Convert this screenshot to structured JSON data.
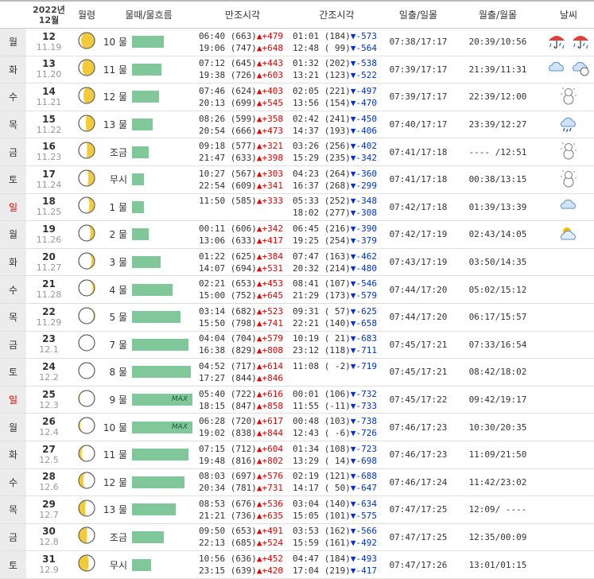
{
  "header": {
    "year": "2022년",
    "month": "12월",
    "moon_phase": "월령",
    "tide_flow": "물때/물흐름",
    "high_tide": "만조시각",
    "low_tide": "간조시각",
    "sunrise_sunset": "일출/일몰",
    "moonrise_moonset": "월출/월몰",
    "weather": "날씨"
  },
  "colors": {
    "bar": "#80c89a",
    "rise": "#e60000",
    "fall": "#0033cc",
    "sunday": "#e00000",
    "weekday_bg": "#ececec"
  },
  "rows": [
    {
      "weekday": "월",
      "sunday": false,
      "day": "12",
      "lunar": "11.19",
      "moon_icon": "waning-gibbous-icon",
      "moon_lit": 0.85,
      "moon_side": "right",
      "mulddae": "10 물",
      "bar": 0.52,
      "max": "",
      "high": [
        {
          "t": "06:40",
          "v": "(663)",
          "arrow": "▲",
          "d": "+479"
        },
        {
          "t": "19:06",
          "v": "(747)",
          "arrow": "▲",
          "d": "+648"
        }
      ],
      "low": [
        {
          "t": "01:01",
          "v": "(184)",
          "arrow": "▼",
          "d": "-573"
        },
        {
          "t": "12:48",
          "v": "( 99)",
          "arrow": "▼",
          "d": "-564"
        }
      ],
      "sun": "07:38/17:17",
      "moon": "20:39/10:56",
      "weather": [
        "rain-umbrella-icon",
        "rain-umbrella-icon"
      ]
    },
    {
      "weekday": "화",
      "sunday": false,
      "day": "13",
      "lunar": "11.20",
      "moon_icon": "waning-gibbous-icon",
      "moon_lit": 0.78,
      "moon_side": "right",
      "mulddae": "11 물",
      "bar": 0.49,
      "max": "",
      "high": [
        {
          "t": "07:12",
          "v": "(645)",
          "arrow": "▲",
          "d": "+443"
        },
        {
          "t": "19:38",
          "v": "(726)",
          "arrow": "▲",
          "d": "+603"
        }
      ],
      "low": [
        {
          "t": "01:32",
          "v": "(202)",
          "arrow": "▼",
          "d": "-538"
        },
        {
          "t": "13:21",
          "v": "(123)",
          "arrow": "▼",
          "d": "-522"
        }
      ],
      "sun": "07:39/17:17",
      "moon": "21:39/11:31",
      "weather": [
        "cloud-icon",
        "cloud-snow-icon"
      ]
    },
    {
      "weekday": "수",
      "sunday": false,
      "day": "14",
      "lunar": "11.21",
      "moon_icon": "waning-gibbous-icon",
      "moon_lit": 0.7,
      "moon_side": "right",
      "mulddae": "12 물",
      "bar": 0.45,
      "max": "",
      "high": [
        {
          "t": "07:46",
          "v": "(624)",
          "arrow": "▲",
          "d": "+403"
        },
        {
          "t": "20:13",
          "v": "(699)",
          "arrow": "▲",
          "d": "+545"
        }
      ],
      "low": [
        {
          "t": "02:05",
          "v": "(221)",
          "arrow": "▼",
          "d": "-497"
        },
        {
          "t": "13:56",
          "v": "(154)",
          "arrow": "▼",
          "d": "-470"
        }
      ],
      "sun": "07:39/17:17",
      "moon": "22:39/12:00",
      "weather": [
        "snowman-icon"
      ]
    },
    {
      "weekday": "목",
      "sunday": false,
      "day": "15",
      "lunar": "11.22",
      "moon_icon": "last-quarter-icon",
      "moon_lit": 0.55,
      "moon_side": "right",
      "mulddae": "13 물",
      "bar": 0.34,
      "max": "",
      "high": [
        {
          "t": "08:26",
          "v": "(599)",
          "arrow": "▲",
          "d": "+358"
        },
        {
          "t": "20:54",
          "v": "(666)",
          "arrow": "▲",
          "d": "+473"
        }
      ],
      "low": [
        {
          "t": "02:42",
          "v": "(241)",
          "arrow": "▼",
          "d": "-450"
        },
        {
          "t": "14:37",
          "v": "(193)",
          "arrow": "▼",
          "d": "-406"
        }
      ],
      "sun": "07:40/17:17",
      "moon": "23:39/12:27",
      "weather": [
        "cloud-rain-icon"
      ]
    },
    {
      "weekday": "금",
      "sunday": false,
      "day": "16",
      "lunar": "11.23",
      "moon_icon": "last-quarter-icon",
      "moon_lit": 0.48,
      "moon_side": "right",
      "mulddae": "조금",
      "bar": 0.27,
      "max": "",
      "high": [
        {
          "t": "09:18",
          "v": "(577)",
          "arrow": "▲",
          "d": "+321"
        },
        {
          "t": "21:47",
          "v": "(633)",
          "arrow": "▲",
          "d": "+398"
        }
      ],
      "low": [
        {
          "t": "03:26",
          "v": "(256)",
          "arrow": "▼",
          "d": "-402"
        },
        {
          "t": "15:29",
          "v": "(235)",
          "arrow": "▼",
          "d": "-342"
        }
      ],
      "sun": "07:41/17:18",
      "moon": "---- /12:51",
      "weather": [
        "snowman-icon"
      ]
    },
    {
      "weekday": "토",
      "sunday": false,
      "day": "17",
      "lunar": "11.24",
      "moon_icon": "waning-crescent-icon",
      "moon_lit": 0.4,
      "moon_side": "right",
      "mulddae": "무시",
      "bar": 0.2,
      "max": "",
      "high": [
        {
          "t": "10:27",
          "v": "(567)",
          "arrow": "▲",
          "d": "+303"
        },
        {
          "t": "22:54",
          "v": "(609)",
          "arrow": "▲",
          "d": "+341"
        }
      ],
      "low": [
        {
          "t": "04:23",
          "v": "(264)",
          "arrow": "▼",
          "d": "-360"
        },
        {
          "t": "16:37",
          "v": "(268)",
          "arrow": "▼",
          "d": "-299"
        }
      ],
      "sun": "07:41/17:18",
      "moon": "00:38/13:15",
      "weather": [
        "snowman-icon"
      ]
    },
    {
      "weekday": "일",
      "sunday": true,
      "day": "18",
      "lunar": "11.25",
      "moon_icon": "waning-crescent-icon",
      "moon_lit": 0.33,
      "moon_side": "right",
      "mulddae": "1 물",
      "bar": 0.2,
      "max": "",
      "high": [
        {
          "t": "11:50",
          "v": "(585)",
          "arrow": "▲",
          "d": "+333"
        },
        {
          "t": "",
          "v": "",
          "arrow": "",
          "d": ""
        }
      ],
      "low": [
        {
          "t": "05:33",
          "v": "(252)",
          "arrow": "▼",
          "d": "-348"
        },
        {
          "t": "18:02",
          "v": "(277)",
          "arrow": "▼",
          "d": "-308"
        }
      ],
      "sun": "07:42/17:18",
      "moon": "01:39/13:39",
      "weather": [
        "cloud-icon"
      ]
    },
    {
      "weekday": "월",
      "sunday": false,
      "day": "19",
      "lunar": "11.26",
      "moon_icon": "waning-crescent-icon",
      "moon_lit": 0.26,
      "moon_side": "right",
      "mulddae": "2 물",
      "bar": 0.27,
      "max": "",
      "high": [
        {
          "t": "00:11",
          "v": "(606)",
          "arrow": "▲",
          "d": "+342"
        },
        {
          "t": "13:06",
          "v": "(633)",
          "arrow": "▲",
          "d": "+417"
        }
      ],
      "low": [
        {
          "t": "06:45",
          "v": "(216)",
          "arrow": "▼",
          "d": "-390"
        },
        {
          "t": "19:25",
          "v": "(254)",
          "arrow": "▼",
          "d": "-379"
        }
      ],
      "sun": "07:42/17:19",
      "moon": "02:43/14:05",
      "weather": [
        "sun-cloud-icon"
      ]
    },
    {
      "weekday": "화",
      "sunday": false,
      "day": "20",
      "lunar": "11.27",
      "moon_icon": "waning-crescent-icon",
      "moon_lit": 0.2,
      "moon_side": "right",
      "mulddae": "3 물",
      "bar": 0.47,
      "max": "",
      "high": [
        {
          "t": "01:22",
          "v": "(625)",
          "arrow": "▲",
          "d": "+384"
        },
        {
          "t": "14:07",
          "v": "(694)",
          "arrow": "▲",
          "d": "+531"
        }
      ],
      "low": [
        {
          "t": "07:47",
          "v": "(163)",
          "arrow": "▼",
          "d": "-462"
        },
        {
          "t": "20:32",
          "v": "(214)",
          "arrow": "▼",
          "d": "-480"
        }
      ],
      "sun": "07:43/17:19",
      "moon": "03:50/14:35",
      "weather": []
    },
    {
      "weekday": "수",
      "sunday": false,
      "day": "21",
      "lunar": "11.28",
      "moon_icon": "waning-crescent-icon",
      "moon_lit": 0.14,
      "moon_side": "right",
      "mulddae": "4 물",
      "bar": 0.67,
      "max": "",
      "high": [
        {
          "t": "02:21",
          "v": "(653)",
          "arrow": "▲",
          "d": "+453"
        },
        {
          "t": "15:00",
          "v": "(752)",
          "arrow": "▲",
          "d": "+645"
        }
      ],
      "low": [
        {
          "t": "08:41",
          "v": "(107)",
          "arrow": "▼",
          "d": "-546"
        },
        {
          "t": "21:29",
          "v": "(173)",
          "arrow": "▼",
          "d": "-579"
        }
      ],
      "sun": "07:44/17:20",
      "moon": "05:02/15:12",
      "weather": []
    },
    {
      "weekday": "목",
      "sunday": false,
      "day": "22",
      "lunar": "11.29",
      "moon_icon": "waning-crescent-icon",
      "moon_lit": 0.08,
      "moon_side": "right",
      "mulddae": "5 물",
      "bar": 0.8,
      "max": "",
      "high": [
        {
          "t": "03:14",
          "v": "(682)",
          "arrow": "▲",
          "d": "+523"
        },
        {
          "t": "15:50",
          "v": "(798)",
          "arrow": "▲",
          "d": "+741"
        }
      ],
      "low": [
        {
          "t": "09:31",
          "v": "( 57)",
          "arrow": "▼",
          "d": "-625"
        },
        {
          "t": "22:21",
          "v": "(140)",
          "arrow": "▼",
          "d": "-658"
        }
      ],
      "sun": "07:44/17:20",
      "moon": "06:17/15:57",
      "weather": []
    },
    {
      "weekday": "금",
      "sunday": false,
      "day": "23",
      "lunar": "12.1",
      "moon_icon": "new-moon-icon",
      "moon_lit": 0.04,
      "moon_side": "left",
      "mulddae": "7 물",
      "bar": 0.93,
      "max": "",
      "high": [
        {
          "t": "04:04",
          "v": "(704)",
          "arrow": "▲",
          "d": "+579"
        },
        {
          "t": "16:38",
          "v": "(829)",
          "arrow": "▲",
          "d": "+808"
        }
      ],
      "low": [
        {
          "t": "10:19",
          "v": "( 21)",
          "arrow": "▼",
          "d": "-683"
        },
        {
          "t": "23:12",
          "v": "(118)",
          "arrow": "▼",
          "d": "-711"
        }
      ],
      "sun": "07:45/17:21",
      "moon": "07:33/16:54",
      "weather": []
    },
    {
      "weekday": "토",
      "sunday": false,
      "day": "24",
      "lunar": "12.2",
      "moon_icon": "new-moon-icon",
      "moon_lit": 0.02,
      "moon_side": "left",
      "mulddae": "8 물",
      "bar": 0.98,
      "max": "",
      "high": [
        {
          "t": "04:52",
          "v": "(717)",
          "arrow": "▲",
          "d": "+614"
        },
        {
          "t": "17:27",
          "v": "(844)",
          "arrow": "▲",
          "d": "+846"
        }
      ],
      "low": [
        {
          "t": "11:08",
          "v": "( -2)",
          "arrow": "▼",
          "d": "-719"
        },
        {
          "t": "",
          "v": "",
          "arrow": "",
          "d": ""
        }
      ],
      "sun": "07:45/17:21",
      "moon": "08:42/18:02",
      "weather": []
    },
    {
      "weekday": "일",
      "sunday": true,
      "day": "25",
      "lunar": "12.3",
      "moon_icon": "waxing-crescent-icon",
      "moon_lit": 0.06,
      "moon_side": "left",
      "mulddae": "9 물",
      "bar": 1.0,
      "max": "MAX",
      "high": [
        {
          "t": "05:40",
          "v": "(722)",
          "arrow": "▲",
          "d": "+616"
        },
        {
          "t": "18:15",
          "v": "(847)",
          "arrow": "▲",
          "d": "+858"
        }
      ],
      "low": [
        {
          "t": "00:01",
          "v": "(106)",
          "arrow": "▼",
          "d": "-732"
        },
        {
          "t": "11:55",
          "v": "(-11)",
          "arrow": "▼",
          "d": "-733"
        }
      ],
      "sun": "07:45/17:22",
      "moon": "09:42/19:17",
      "weather": []
    },
    {
      "weekday": "월",
      "sunday": false,
      "day": "26",
      "lunar": "12.4",
      "moon_icon": "waxing-crescent-icon",
      "moon_lit": 0.1,
      "moon_side": "left",
      "mulddae": "10 물",
      "bar": 1.0,
      "max": "MAX",
      "high": [
        {
          "t": "06:28",
          "v": "(720)",
          "arrow": "▲",
          "d": "+617"
        },
        {
          "t": "19:02",
          "v": "(838)",
          "arrow": "▲",
          "d": "+844"
        }
      ],
      "low": [
        {
          "t": "00:48",
          "v": "(103)",
          "arrow": "▼",
          "d": "-738"
        },
        {
          "t": "12:43",
          "v": "( -6)",
          "arrow": "▼",
          "d": "-726"
        }
      ],
      "sun": "07:46/17:23",
      "moon": "10:30/20:35",
      "weather": []
    },
    {
      "weekday": "화",
      "sunday": false,
      "day": "27",
      "lunar": "12.5",
      "moon_icon": "waxing-crescent-icon",
      "moon_lit": 0.18,
      "moon_side": "left",
      "mulddae": "11 물",
      "bar": 0.93,
      "max": "",
      "high": [
        {
          "t": "07:15",
          "v": "(712)",
          "arrow": "▲",
          "d": "+604"
        },
        {
          "t": "19:48",
          "v": "(816)",
          "arrow": "▲",
          "d": "+802"
        }
      ],
      "low": [
        {
          "t": "01:34",
          "v": "(108)",
          "arrow": "▼",
          "d": "-723"
        },
        {
          "t": "13:29",
          "v": "( 14)",
          "arrow": "▼",
          "d": "-698"
        }
      ],
      "sun": "07:46/17:23",
      "moon": "11:09/21:50",
      "weather": []
    },
    {
      "weekday": "수",
      "sunday": false,
      "day": "28",
      "lunar": "12.6",
      "moon_icon": "waxing-crescent-icon",
      "moon_lit": 0.28,
      "moon_side": "left",
      "mulddae": "12 물",
      "bar": 0.87,
      "max": "",
      "high": [
        {
          "t": "08:03",
          "v": "(697)",
          "arrow": "▲",
          "d": "+576"
        },
        {
          "t": "20:34",
          "v": "(781)",
          "arrow": "▲",
          "d": "+731"
        }
      ],
      "low": [
        {
          "t": "02:19",
          "v": "(121)",
          "arrow": "▼",
          "d": "-688"
        },
        {
          "t": "14:17",
          "v": "( 50)",
          "arrow": "▼",
          "d": "-647"
        }
      ],
      "sun": "07:46/17:24",
      "moon": "11:42/23:02",
      "weather": []
    },
    {
      "weekday": "목",
      "sunday": false,
      "day": "29",
      "lunar": "12.7",
      "moon_icon": "first-quarter-icon",
      "moon_lit": 0.4,
      "moon_side": "left",
      "mulddae": "13 물",
      "bar": 0.73,
      "max": "",
      "high": [
        {
          "t": "08:53",
          "v": "(676)",
          "arrow": "▲",
          "d": "+536"
        },
        {
          "t": "21:21",
          "v": "(736)",
          "arrow": "▲",
          "d": "+635"
        }
      ],
      "low": [
        {
          "t": "03:04",
          "v": "(140)",
          "arrow": "▼",
          "d": "-634"
        },
        {
          "t": "15:05",
          "v": "(101)",
          "arrow": "▼",
          "d": "-575"
        }
      ],
      "sun": "07:47/17:25",
      "moon": "12:09/ ----",
      "weather": []
    },
    {
      "weekday": "금",
      "sunday": false,
      "day": "30",
      "lunar": "12.8",
      "moon_icon": "first-quarter-icon",
      "moon_lit": 0.52,
      "moon_side": "left",
      "mulddae": "조금",
      "bar": 0.53,
      "max": "",
      "high": [
        {
          "t": "09:50",
          "v": "(653)",
          "arrow": "▲",
          "d": "+491"
        },
        {
          "t": "22:13",
          "v": "(685)",
          "arrow": "▲",
          "d": "+524"
        }
      ],
      "low": [
        {
          "t": "03:53",
          "v": "(162)",
          "arrow": "▼",
          "d": "-566"
        },
        {
          "t": "15:59",
          "v": "(161)",
          "arrow": "▼",
          "d": "-492"
        }
      ],
      "sun": "07:47/17:25",
      "moon": "12:35/00:09",
      "weather": []
    },
    {
      "weekday": "토",
      "sunday": false,
      "day": "31",
      "lunar": "12.9",
      "moon_icon": "waxing-gibbous-icon",
      "moon_lit": 0.62,
      "moon_side": "left",
      "mulddae": "무시",
      "bar": 0.31,
      "max": "",
      "high": [
        {
          "t": "10:56",
          "v": "(636)",
          "arrow": "▲",
          "d": "+452"
        },
        {
          "t": "23:15",
          "v": "(639)",
          "arrow": "▲",
          "d": "+420"
        }
      ],
      "low": [
        {
          "t": "04:47",
          "v": "(184)",
          "arrow": "▼",
          "d": "-493"
        },
        {
          "t": "17:04",
          "v": "(219)",
          "arrow": "▼",
          "d": "-417"
        }
      ],
      "sun": "07:47/17:26",
      "moon": "13:01/01:15",
      "weather": []
    }
  ]
}
